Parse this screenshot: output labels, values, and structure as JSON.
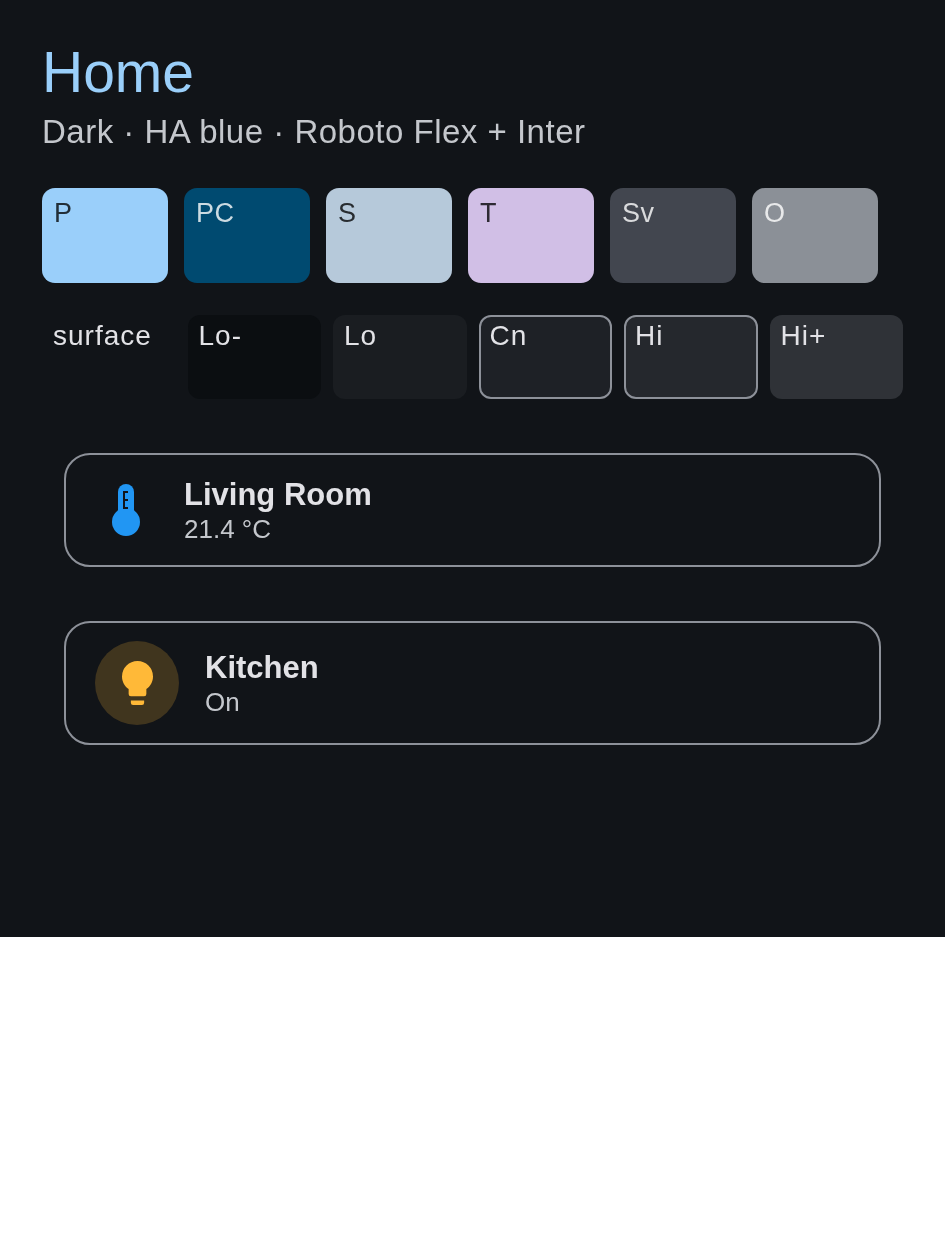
{
  "header": {
    "title": "Home",
    "subtitle": "Dark · HA blue · Roboto Flex + Inter"
  },
  "swatches": [
    {
      "label": "P",
      "color": "#9acffa"
    },
    {
      "label": "PC",
      "color": "#004a70"
    },
    {
      "label": "S",
      "color": "#b6c9da"
    },
    {
      "label": "T",
      "color": "#d1bfe6"
    },
    {
      "label": "Sv",
      "color": "#42464f"
    },
    {
      "label": "O",
      "color": "#8b9097"
    }
  ],
  "surface": {
    "label": "surface",
    "tiles": [
      {
        "label": "Lo-",
        "color": "#0b0e11",
        "outlined": false
      },
      {
        "label": "Lo",
        "color": "#1a1d21",
        "outlined": false
      },
      {
        "label": "Cn",
        "color": "#1e2126",
        "outlined": true
      },
      {
        "label": "Hi",
        "color": "#25282d",
        "outlined": true
      },
      {
        "label": "Hi+",
        "color": "#2f3237",
        "outlined": false
      }
    ]
  },
  "cards": [
    {
      "kind": "sensor",
      "name": "Living Room",
      "state": "21.4 °C",
      "color": "#2196f3",
      "on": false
    },
    {
      "kind": "light",
      "name": "Kitchen",
      "state": "On",
      "color": "#ffb938",
      "on": true
    }
  ]
}
